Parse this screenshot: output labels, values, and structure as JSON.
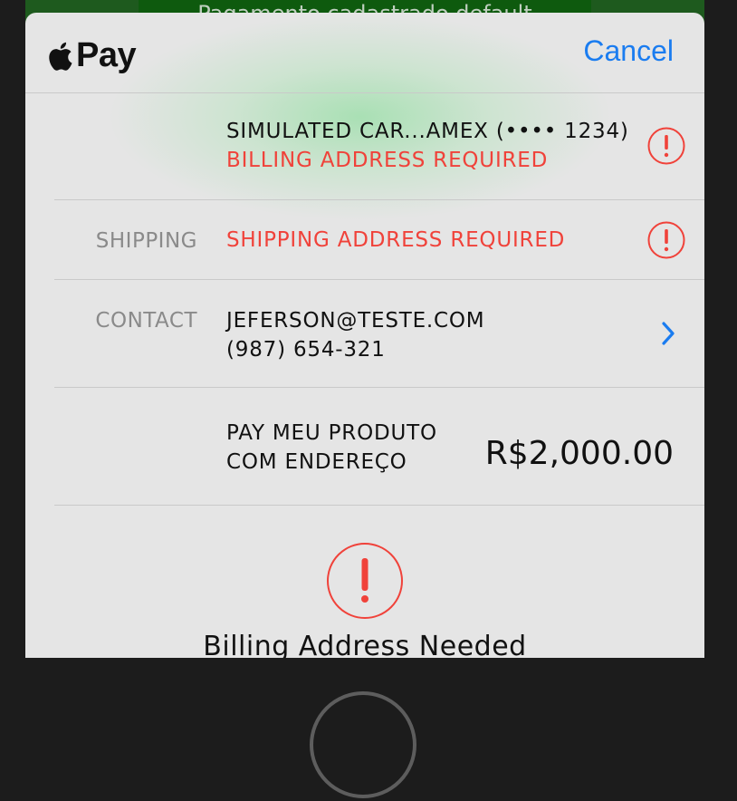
{
  "behind": {
    "button_label": "Pagamento cadastrado default"
  },
  "header": {
    "logo_text": "Pay",
    "cancel_label": "Cancel"
  },
  "card": {
    "label": "",
    "name": "SIMULATED CAR...AMEX (•••• 1234)",
    "error": "BILLING ADDRESS REQUIRED"
  },
  "shipping": {
    "label": "SHIPPING",
    "error": "SHIPPING ADDRESS REQUIRED"
  },
  "contact": {
    "label": "CONTACT",
    "email": "JEFERSON@TESTE.COM",
    "phone": "(987) 654-321"
  },
  "summary": {
    "line1": "PAY MEU PRODUTO",
    "line2": "COM ENDEREÇO",
    "amount": "R$2,000.00"
  },
  "status": {
    "message": "Billing Address Needed"
  },
  "colors": {
    "accent": "#1a7cf0",
    "error": "#f0423a",
    "sheet": "#e5e5e5",
    "bezel": "#1c1c1c"
  }
}
